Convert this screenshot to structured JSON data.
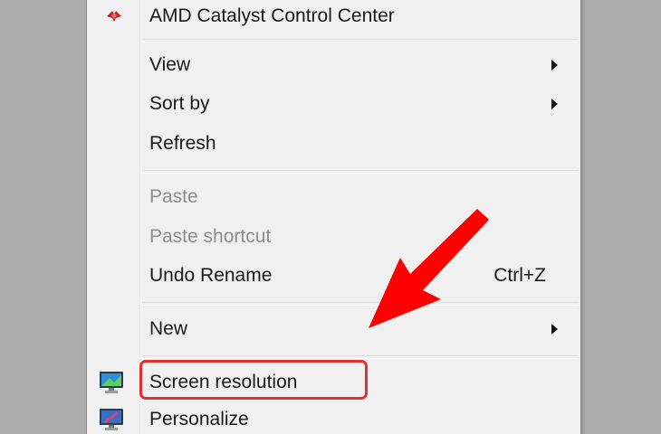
{
  "menu": {
    "items": [
      {
        "label": "AMD Catalyst Control Center",
        "icon": "amd-catalyst-icon",
        "disabled": false
      },
      {
        "label": "View",
        "submenu": true
      },
      {
        "label": "Sort by",
        "submenu": true
      },
      {
        "label": "Refresh"
      },
      {
        "label": "Paste",
        "disabled": true
      },
      {
        "label": "Paste shortcut",
        "disabled": true
      },
      {
        "label": "Undo Rename",
        "shortcut": "Ctrl+Z"
      },
      {
        "label": "New",
        "submenu": true
      },
      {
        "label": "Screen resolution",
        "icon": "screen-resolution-icon",
        "highlighted": true
      },
      {
        "label": "Personalize",
        "icon": "personalize-icon"
      }
    ]
  },
  "colors": {
    "highlight_border": "#e03030",
    "annotation_arrow": "#ff0000",
    "menu_background": "#f0f0f0",
    "disabled_text": "#8d8d8d"
  }
}
